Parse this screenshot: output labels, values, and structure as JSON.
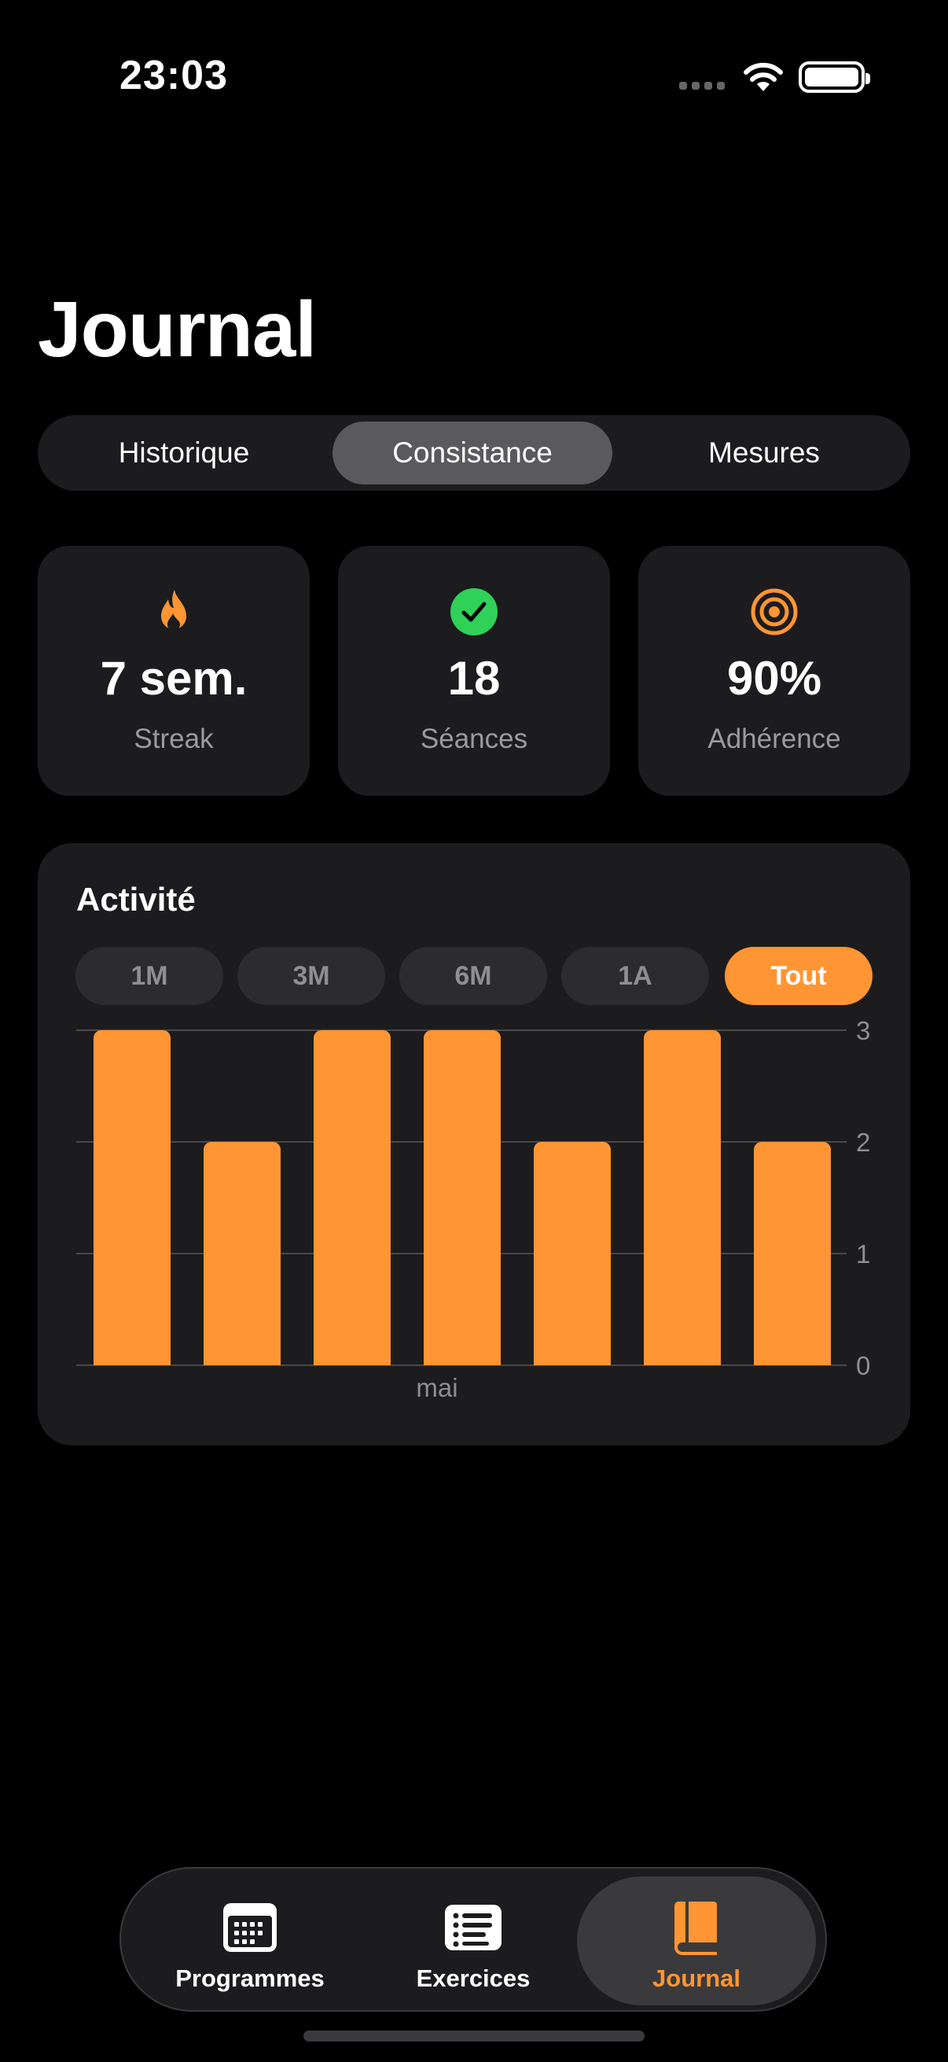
{
  "status": {
    "time": "23:03"
  },
  "header": {
    "title": "Journal"
  },
  "segments": [
    {
      "label": "Historique",
      "active": false
    },
    {
      "label": "Consistance",
      "active": true
    },
    {
      "label": "Mesures",
      "active": false
    }
  ],
  "stats": [
    {
      "value": "7 sem.",
      "label": "Streak",
      "icon": "flame-icon",
      "color": "#ff9533"
    },
    {
      "value": "18",
      "label": "Séances",
      "icon": "checkmark-circle-icon",
      "color": "#30d158"
    },
    {
      "value": "90%",
      "label": "Adhérence",
      "icon": "target-icon",
      "color": "#ff9533"
    }
  ],
  "activity": {
    "title": "Activité",
    "ranges": [
      {
        "label": "1M",
        "active": false
      },
      {
        "label": "3M",
        "active": false
      },
      {
        "label": "6M",
        "active": false
      },
      {
        "label": "1A",
        "active": false
      },
      {
        "label": "Tout",
        "active": true
      }
    ]
  },
  "chart_data": {
    "type": "bar",
    "xlabel": "mai",
    "values": [
      3,
      2,
      3,
      3,
      2,
      3,
      2
    ],
    "ylim": [
      0,
      3
    ],
    "yticks": [
      0,
      1,
      2,
      3
    ],
    "grid": true,
    "color": "#ff9533"
  },
  "tabbar": [
    {
      "label": "Programmes",
      "icon": "calendar-icon",
      "active": false
    },
    {
      "label": "Exercices",
      "icon": "list-icon",
      "active": false
    },
    {
      "label": "Journal",
      "icon": "book-icon",
      "active": true
    }
  ],
  "colors": {
    "accent": "#ff9533",
    "success": "#30d158",
    "card": "#1c1c1e"
  }
}
